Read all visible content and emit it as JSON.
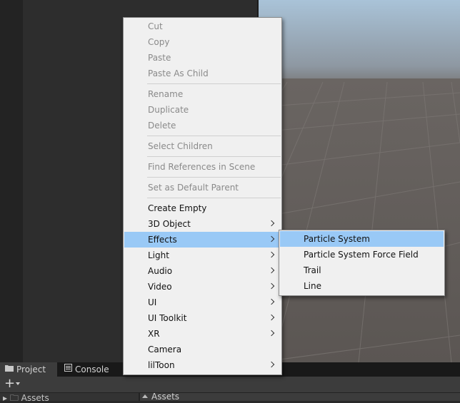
{
  "main_menu": {
    "groups": [
      [
        {
          "label": "Cut",
          "disabled": true
        },
        {
          "label": "Copy",
          "disabled": true
        },
        {
          "label": "Paste",
          "disabled": true
        },
        {
          "label": "Paste As Child",
          "disabled": true
        }
      ],
      [
        {
          "label": "Rename",
          "disabled": true
        },
        {
          "label": "Duplicate",
          "disabled": true
        },
        {
          "label": "Delete",
          "disabled": true
        }
      ],
      [
        {
          "label": "Select Children",
          "disabled": true
        }
      ],
      [
        {
          "label": "Find References in Scene",
          "disabled": true
        }
      ],
      [
        {
          "label": "Set as Default Parent",
          "disabled": true
        }
      ],
      [
        {
          "label": "Create Empty"
        },
        {
          "label": "3D Object",
          "submenu": true
        },
        {
          "label": "Effects",
          "submenu": true,
          "highlighted": true
        },
        {
          "label": "Light",
          "submenu": true
        },
        {
          "label": "Audio",
          "submenu": true
        },
        {
          "label": "Video",
          "submenu": true
        },
        {
          "label": "UI",
          "submenu": true
        },
        {
          "label": "UI Toolkit",
          "submenu": true
        },
        {
          "label": "XR",
          "submenu": true
        },
        {
          "label": "Camera"
        },
        {
          "label": "lilToon",
          "submenu": true
        }
      ]
    ]
  },
  "sub_menu": {
    "items": [
      {
        "label": "Particle System",
        "highlighted": true
      },
      {
        "label": "Particle System Force Field"
      },
      {
        "label": "Trail"
      },
      {
        "label": "Line"
      }
    ]
  },
  "bottom_panel": {
    "tabs": [
      {
        "label": "Project",
        "icon": "folder-icon",
        "active": true
      },
      {
        "label": "Console",
        "icon": "console-icon",
        "active": false
      }
    ],
    "add_button": "+",
    "tree_root": "Assets",
    "path": "Assets"
  },
  "colors": {
    "menu_bg": "#f0f0f0",
    "highlight": "#99c9f6",
    "disabled_text": "#8a8a8a",
    "editor_dark": "#282828"
  }
}
